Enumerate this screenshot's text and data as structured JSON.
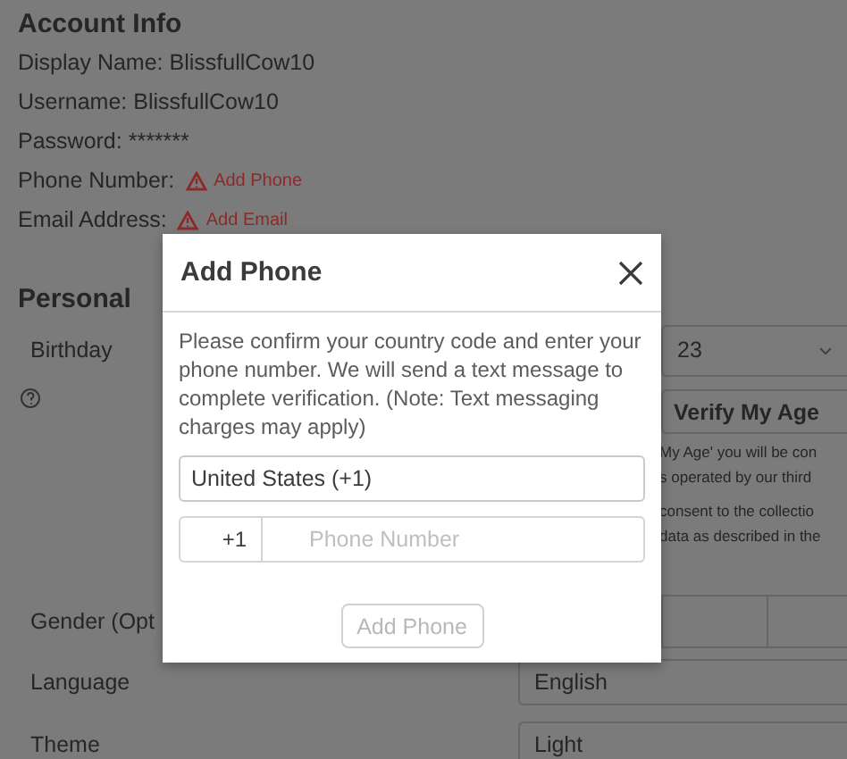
{
  "account_info": {
    "title": "Account Info",
    "fields": [
      {
        "label": "Display Name:",
        "value": "BlissfullCow10"
      },
      {
        "label": "Username:",
        "value": "BlissfullCow10"
      },
      {
        "label": "Password:",
        "value": "*******"
      }
    ],
    "phone": {
      "label": "Phone Number:",
      "action": "Add Phone"
    },
    "email": {
      "label": "Email Address:",
      "action": "Add Email"
    }
  },
  "personal": {
    "title": "Personal",
    "birthday": {
      "label": "Birthday",
      "day": "23"
    },
    "verify_button": "Verify My Age",
    "notice_lines": [
      "My Age' you will be con",
      "s operated by our third",
      "consent to the collectio",
      "data as described in the"
    ],
    "gender": {
      "label": "Gender (Opt"
    },
    "language": {
      "label": "Language",
      "value": "English"
    },
    "theme": {
      "label": "Theme",
      "value": "Light"
    }
  },
  "modal": {
    "title": "Add Phone",
    "message": "Please confirm your country code and enter your phone number. We will send a text message to complete verification. (Note: Text messaging charges may apply)",
    "country": "United States (+1)",
    "phone_code": "+1",
    "phone_placeholder": "Phone Number",
    "submit": {
      "label": "Add Phone",
      "disabled": true
    }
  }
}
